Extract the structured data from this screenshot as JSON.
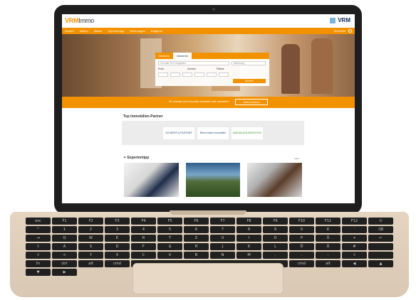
{
  "site": {
    "logo_brand": "VRM",
    "logo_rest": "Immo",
    "corner_badge": "VRM"
  },
  "nav": {
    "items": [
      "Kaufen",
      "Mieten",
      "Makler",
      "Expertentipp",
      "Wohnungen",
      "Ratgeber"
    ],
    "account": "Merkliste"
  },
  "search": {
    "tabs": [
      "Wohnen",
      "Gewerbe"
    ],
    "location_placeholder": "Ort oder PLZ eingeben",
    "type_placeholder": "Wohnung",
    "price_label": "Preis",
    "rooms_label": "Zimmer",
    "area_label": "Fläche",
    "submit": "Suchen"
  },
  "band": {
    "text": "Sie möchten Ihre Immobilie verkaufen oder vermieten?",
    "button": "Jetzt inserieren"
  },
  "partners": {
    "title": "Top Immobilien-Partner",
    "logos": [
      "SCHÄFER & PARTNER",
      "Rhein-Nahe Immobilien",
      "IMMOBILIEN BERATUNG"
    ]
  },
  "tipps": {
    "title": "Expertentipp",
    "more": "mehr"
  },
  "keyboard": {
    "keys": [
      "esc",
      "F1",
      "F2",
      "F3",
      "F4",
      "F5",
      "F6",
      "F7",
      "F8",
      "F9",
      "F10",
      "F11",
      "F12",
      "⏻",
      "^",
      "1",
      "2",
      "3",
      "4",
      "5",
      "6",
      "7",
      "8",
      "9",
      "0",
      "ß",
      "´",
      "⌫",
      "⇥",
      "Q",
      "W",
      "E",
      "R",
      "T",
      "Z",
      "U",
      "I",
      "O",
      "P",
      "Ü",
      "+",
      "↵",
      "⇪",
      "A",
      "S",
      "D",
      "F",
      "G",
      "H",
      "J",
      "K",
      "L",
      "Ö",
      "Ä",
      "#",
      "",
      "⇧",
      "<",
      "Y",
      "X",
      "C",
      "V",
      "B",
      "N",
      "M",
      ",",
      ".",
      "-",
      "⇧",
      "",
      "fn",
      "ctrl",
      "alt",
      "cmd",
      "",
      "cmd",
      "alt",
      "◀",
      "▲",
      "▼",
      "▶"
    ]
  }
}
